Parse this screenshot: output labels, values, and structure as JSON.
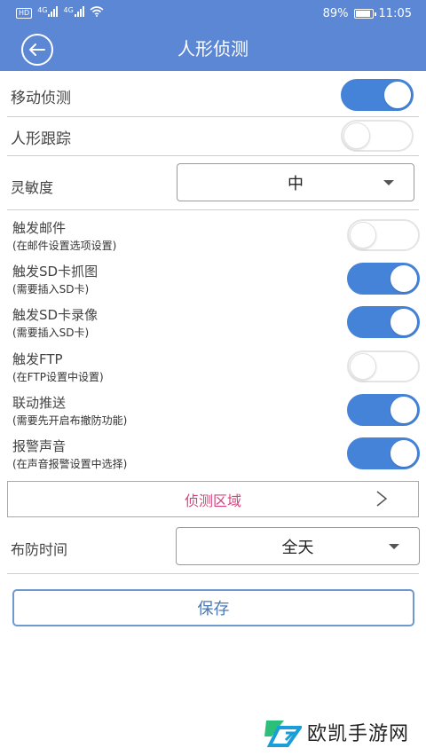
{
  "status_bar": {
    "hd": "HD",
    "net1": "4G",
    "net2": "4G",
    "battery_percent": "89%",
    "battery_level": 0.89,
    "time": "11:05"
  },
  "header": {
    "title": "人形侦测",
    "back_icon": "arrow-left-circle-icon"
  },
  "settings": {
    "motion_detect": {
      "label": "移动侦测",
      "on": true
    },
    "human_track": {
      "label": "人形跟踪",
      "on": false
    },
    "sensitivity": {
      "label": "灵敏度",
      "value": "中"
    },
    "trigger_email": {
      "label": "触发邮件",
      "sub": "(在邮件设置选项设置)",
      "on": false
    },
    "trigger_sd_snap": {
      "label": "触发SD卡抓图",
      "sub": "(需要插入SD卡)",
      "on": true
    },
    "trigger_sd_record": {
      "label": "触发SD卡录像",
      "sub": "(需要插入SD卡)",
      "on": true
    },
    "trigger_ftp": {
      "label": "触发FTP",
      "sub": "(在FTP设置中设置)",
      "on": false
    },
    "linked_push": {
      "label": "联动推送",
      "sub": "(需要先开启布撤防功能)",
      "on": true
    },
    "alarm_sound": {
      "label": "报警声音",
      "sub": "(在声音报警设置中选择)",
      "on": true
    }
  },
  "detect_zone": {
    "label": "侦测区域",
    "chevron": ">"
  },
  "schedule": {
    "label": "布防时间",
    "value": "全天"
  },
  "save_label": "保存",
  "watermark": {
    "text": "欧凯手游网"
  },
  "colors": {
    "header": "#5b87d5",
    "toggle_on": "#4583d8",
    "zone_text": "#d4437c",
    "save_border": "#6f98cf"
  }
}
